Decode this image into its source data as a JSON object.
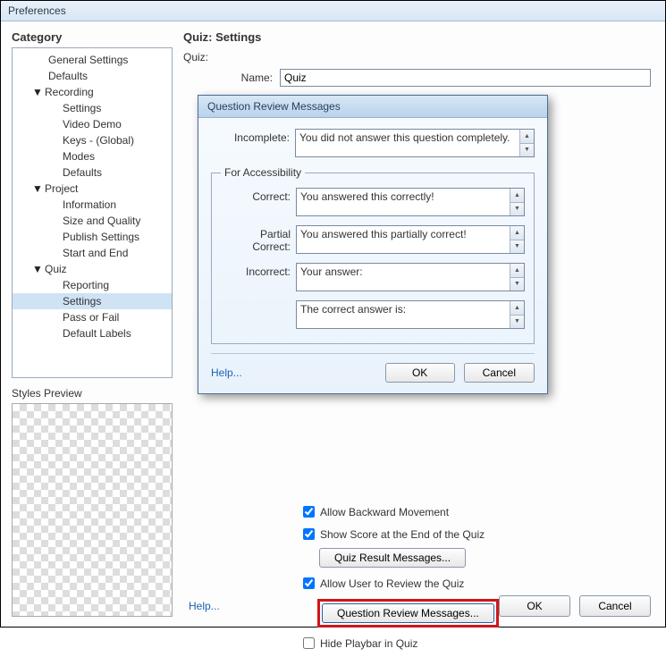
{
  "window": {
    "title": "Preferences"
  },
  "left": {
    "heading": "Category",
    "styles_label": "Styles Preview",
    "tree": {
      "general": "General Settings",
      "defaults": "Defaults",
      "recording": "Recording",
      "rec_settings": "Settings",
      "rec_video": "Video Demo",
      "rec_keys": "Keys - (Global)",
      "rec_modes": "Modes",
      "rec_defaults": "Defaults",
      "project": "Project",
      "proj_info": "Information",
      "proj_size": "Size and Quality",
      "proj_publish": "Publish Settings",
      "proj_startend": "Start and End",
      "quiz": "Quiz",
      "quiz_reporting": "Reporting",
      "quiz_settings": "Settings",
      "quiz_pass": "Pass or Fail",
      "quiz_labels": "Default Labels"
    }
  },
  "right": {
    "heading": "Quiz: Settings",
    "quiz_label": "Quiz:",
    "name_label": "Name:",
    "name_value": "Quiz",
    "chk_backward": "Allow Backward Movement",
    "chk_score": "Show Score at the End of the Quiz",
    "btn_result_msgs": "Quiz Result Messages...",
    "chk_review": "Allow User to Review the Quiz",
    "btn_question_msgs": "Question Review Messages...",
    "chk_hide_playbar": "Hide Playbar in Quiz",
    "help": "Help...",
    "ok": "OK",
    "cancel": "Cancel"
  },
  "dialog": {
    "title": "Question Review Messages",
    "incomplete_label": "Incomplete:",
    "incomplete_value": "You did not answer this question completely.",
    "access_legend": "For Accessibility",
    "correct_label": "Correct:",
    "correct_value": "You answered this correctly!",
    "partial_label": "Partial Correct:",
    "partial_value": "You answered this partially correct!",
    "incorrect_label": "Incorrect:",
    "incorrect_value": "Your answer:",
    "answer_value": "The correct answer is:",
    "help": "Help...",
    "ok": "OK",
    "cancel": "Cancel"
  }
}
